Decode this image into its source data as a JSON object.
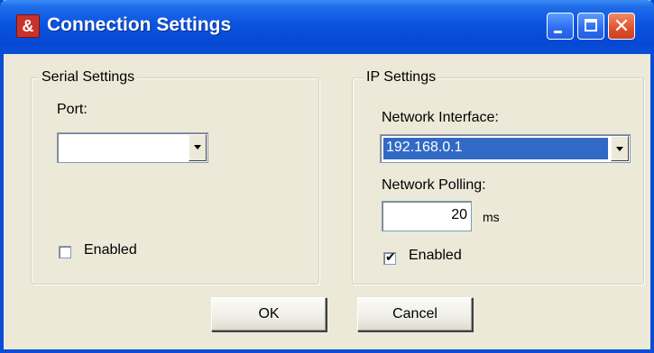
{
  "window": {
    "title": "Connection Settings",
    "app_icon_glyph": "&"
  },
  "serial": {
    "legend": "Serial Settings",
    "port_label": "Port:",
    "port_value": "",
    "enabled_label": "Enabled",
    "enabled": false
  },
  "ip": {
    "legend": "IP Settings",
    "interface_label": "Network Interface:",
    "interface_value": "192.168.0.1",
    "polling_label": "Network Polling:",
    "polling_value": "20",
    "polling_unit": "ms",
    "enabled_label": "Enabled",
    "enabled": true
  },
  "buttons": {
    "ok": "OK",
    "cancel": "Cancel"
  }
}
